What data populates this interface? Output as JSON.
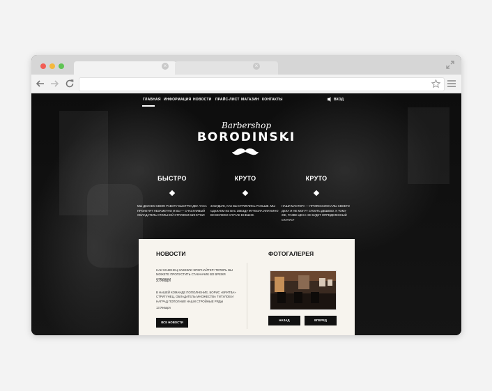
{
  "browser": {
    "icons": {
      "back": "arrow-left-icon",
      "forward": "arrow-right-icon",
      "reload": "reload-icon",
      "bookmark": "star-icon",
      "menu": "hamburger-menu-icon",
      "tab_close": "close-icon",
      "expand": "expand-arrows-icon"
    },
    "tab_close_glyph": "×"
  },
  "site": {
    "nav": [
      {
        "label": "ГЛАВНАЯ",
        "active": true
      },
      {
        "label": "ИНФОРМАЦИЯ"
      },
      {
        "label": "НОВОСТИ"
      },
      {
        "label": "ПРАЙС-ЛИСТ"
      },
      {
        "label": "МАГАЗИН"
      },
      {
        "label": "КОНТАКТЫ"
      }
    ],
    "login": "ВХОД",
    "brand": {
      "script": "Barbershop",
      "name": "BORODINSKI",
      "logo_icon": "mustache-icon"
    },
    "features": [
      {
        "title": "БЫСТРО",
        "text": "МЫ ДЕЛАЕМ СВОЮ РАБОТУ БЫСТРО! ДВА ЧАСА ПРОЛЕТЯТ НЕЗАМЕТНО И ВЫ — СЧАСТЛИВЫЙ ОБЛАДАТЕЛЬ СТИЛЬНОЙ СТРИЖКИ-МИНУТКИ!"
      },
      {
        "title": "КРУТО",
        "text": "ЗАБУДЬТЕ, КАК ВЫ СТРИГЛИСЬ РАНЬШЕ. МЫ СДЕЛАЕМ ИЗ ВАС ЗВЕЗДУ ФУТБОЛА ИЛИ КИНО ВО ВСЯКОМ СЛУЧАЕ ВНЕШНЕ."
      },
      {
        "title": "КРУТО",
        "text": "НАШИ МАСТЕРА — ПРОФЕССИОНАЛЫ СВОЕГО ДЕЛА И НЕ МОГУТ СТОИТЬ ДЕШЕВО. К ТОМУ ЖЕ, РАЗВЕ ЦЕНА НЕ БУДЕТ ОПРЕДЕЛЕННЫЙ СТАТУС?"
      }
    ],
    "news": {
      "title": "НОВОСТИ",
      "items": [
        {
          "text": "НАИ МАКЕНЕЦ ЗАВЕЗЛИ ЭПЕРНАЙТЕР! ТЕПЕРЬ ВЫ МОЖЕТЕ ПРОПУСТИТЬ СТАКАНЧИК ВО ВРЕМЯ СТРИЖКИ",
          "date": "20 Января"
        },
        {
          "text": "В НАШЕЙ КОМАНДЕ ПОПОЛНЕНИЕ, БОРИС «БРИТВА» СТРИГУНЕЦ, ОБЛАДАТЕЛЬ МНОЖЕСТВА ТИТУЛОВ И НАГРАД ПОПОЛНИЛ НАШИ СТРОЙНЫЕ РЯДЫ",
          "date": "13 Января"
        }
      ],
      "all_button": "ВСЕ НОВОСТИ"
    },
    "gallery": {
      "title": "ФОТОГАЛЕРЕЯ",
      "prev_button": "НАЗАД",
      "next_button": "ВПЕРЕД"
    }
  }
}
